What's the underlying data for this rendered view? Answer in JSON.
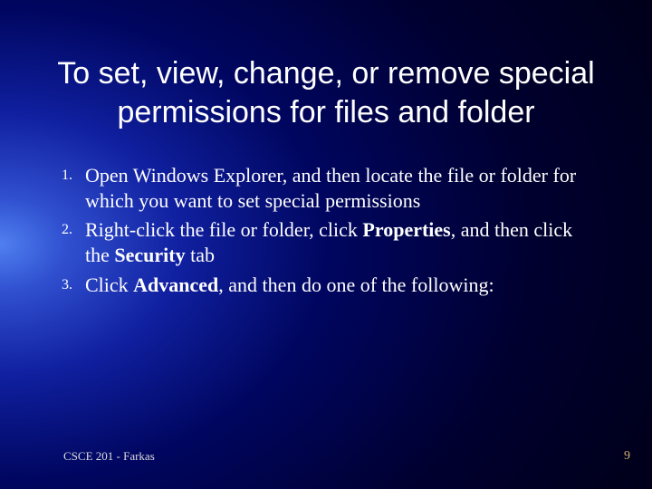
{
  "title": "To set, view, change, or remove special permissions for files and folder",
  "items": [
    {
      "num": "1.",
      "segments": [
        {
          "t": "Open Windows Explorer, and then locate the file or folder for which you want to set special permissions",
          "b": false
        }
      ]
    },
    {
      "num": "2.",
      "segments": [
        {
          "t": "Right-click the file or folder, click ",
          "b": false
        },
        {
          "t": "Properties",
          "b": true
        },
        {
          "t": ", and then click the ",
          "b": false
        },
        {
          "t": "Security",
          "b": true
        },
        {
          "t": " tab",
          "b": false
        }
      ]
    },
    {
      "num": "3.",
      "segments": [
        {
          "t": "Click ",
          "b": false
        },
        {
          "t": "Advanced",
          "b": true
        },
        {
          "t": ", and then do one of the following:",
          "b": false
        }
      ]
    }
  ],
  "footer_left": "CSCE 201 - Farkas",
  "footer_right": "9"
}
